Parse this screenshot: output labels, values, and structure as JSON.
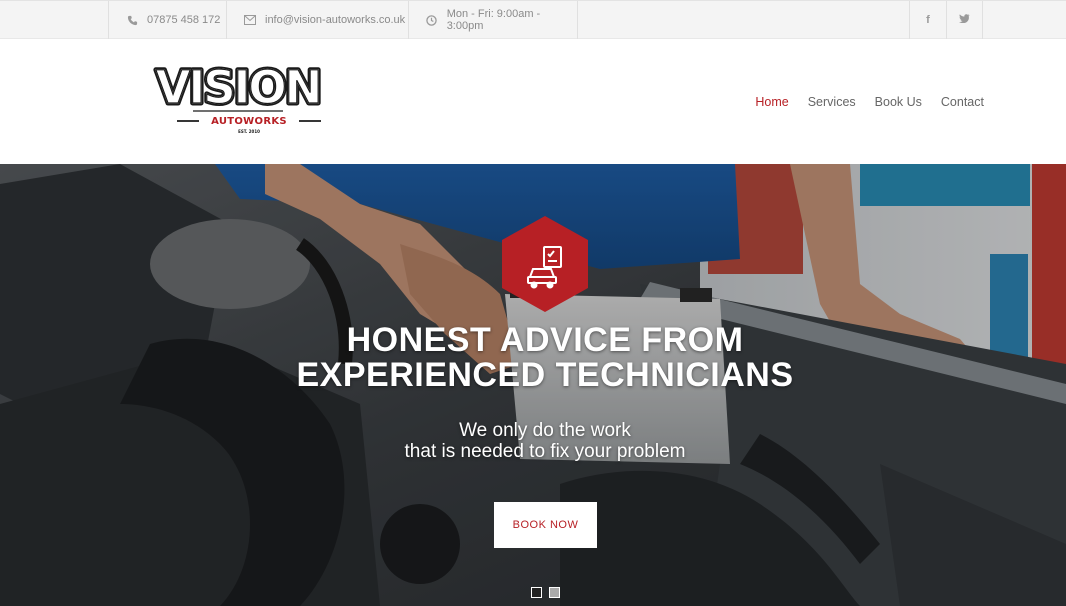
{
  "topbar": {
    "phone": "07875 458 172",
    "email": "info@vision-autoworks.co.uk",
    "hours": "Mon - Fri: 9:00am - 3:00pm",
    "phone_icon": "phone-icon",
    "email_icon": "envelope-icon",
    "hours_icon": "clock-icon",
    "social": [
      {
        "label": "f",
        "icon": "facebook-icon"
      },
      {
        "label": "t",
        "icon": "twitter-icon"
      }
    ]
  },
  "logo": {
    "main": "VISION",
    "sub": "AUTOWORKS",
    "est": "EST. 2010"
  },
  "nav": {
    "items": [
      {
        "label": "Home",
        "active": true
      },
      {
        "label": "Services",
        "active": false
      },
      {
        "label": "Book Us",
        "active": false
      },
      {
        "label": "Contact",
        "active": false
      }
    ]
  },
  "hero": {
    "title_line1": "HONEST ADVICE FROM",
    "title_line2": "EXPERIENCED TECHNICIANS",
    "subtitle_line1": "We only do the work",
    "subtitle_line2": "that is needed to fix your problem",
    "button_label": "BOOK NOW",
    "badge_icon": "car-checklist-icon",
    "slides": 2,
    "active_slide": 1
  },
  "colors": {
    "accent": "#b72025",
    "topbar_bg": "#f4f4f4",
    "nav_text": "#666666"
  }
}
